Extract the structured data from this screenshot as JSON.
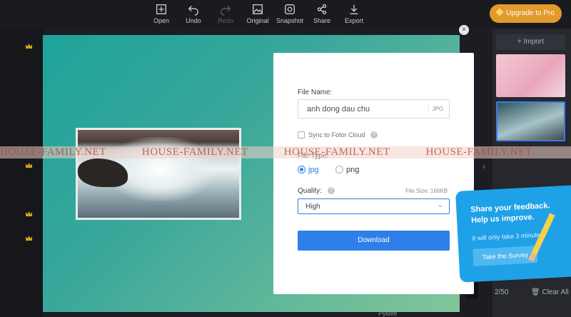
{
  "toolbar": {
    "open": "Open",
    "undo": "Undo",
    "redo": "Redo",
    "original": "Original",
    "snapshot": "Snapshot",
    "share": "Share",
    "export": "Export",
    "upgrade": "Upgrade to Pro"
  },
  "right_panel": {
    "import": "Import",
    "counter": "2/50",
    "clear_all": "Clear All"
  },
  "dialog": {
    "file_name_label": "File Name:",
    "file_name_value": "anh dong dau chu",
    "file_ext": "JPG",
    "sync_label": "Sync to Fotor Cloud",
    "file_type_label": "File Type:",
    "type_jpg": "jpg",
    "type_png": "png",
    "quality_label": "Quality:",
    "file_size": "File Size: 166KB",
    "quality_value": "High",
    "download": "Download",
    "close": "×"
  },
  "watermark": [
    "HOUSE-FAMILY.NET",
    "HOUSE-FAMILY.NET",
    "HOUSE-FAMILY.NET",
    "HOUSE-FAMILY.NET"
  ],
  "feedback": {
    "title": "Share your feedback. Help us improve.",
    "subtitle": "It will only take 3 minutes",
    "button": "Take the Survey"
  },
  "footer": {
    "brand": "PyBee"
  },
  "colors": {
    "accent": "#2f7fe8",
    "upgrade": "#e29a2a",
    "feedback": "#1fa1e8"
  }
}
